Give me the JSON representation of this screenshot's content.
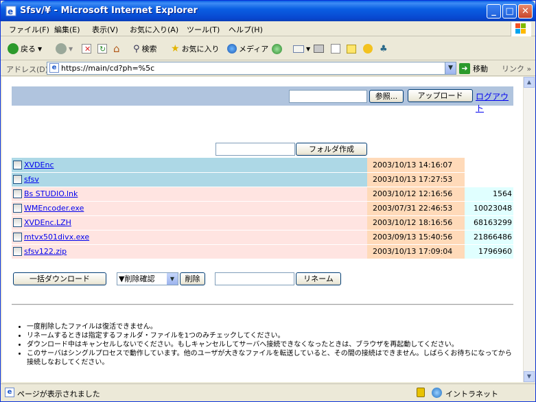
{
  "window": {
    "title": "Sfsv/¥ - Microsoft Internet Explorer",
    "minimize": "_",
    "maximize": "□",
    "close": "✕"
  },
  "menu": [
    "ファイル(F)",
    "編集(E)",
    "表示(V)",
    "お気に入り(A)",
    "ツール(T)",
    "ヘルプ(H)"
  ],
  "toolbar": {
    "back": "戻る",
    "search": "検索",
    "favorites": "お気に入り",
    "media": "メディア"
  },
  "address": {
    "label": "アドレス(D)",
    "url": "https://main/cd?ph=%5c",
    "go": "移動",
    "links": "リンク"
  },
  "upload": {
    "browse": "参照...",
    "upload": "アップロード",
    "logout": "ログアウト"
  },
  "folder": {
    "create": "フォルダ作成"
  },
  "files": [
    {
      "name": "XVDEnc",
      "date": "2003/10/13 14:16:07",
      "size": "",
      "kind": "dir"
    },
    {
      "name": "sfsv",
      "date": "2003/10/13 17:27:53",
      "size": "",
      "kind": "dir"
    },
    {
      "name": "Bs STUDIO.lnk",
      "date": "2003/10/12 12:16:56",
      "size": "1564",
      "kind": "file"
    },
    {
      "name": "WMEncoder.exe",
      "date": "2003/07/31 22:46:53",
      "size": "10023048",
      "kind": "file"
    },
    {
      "name": "XVDEnc.LZH",
      "date": "2003/10/12 18:16:56",
      "size": "68163299",
      "kind": "file"
    },
    {
      "name": "mtvx501divx.exe",
      "date": "2003/09/13 15:40:56",
      "size": "21866486",
      "kind": "file"
    },
    {
      "name": "sfsv122.zip",
      "date": "2003/10/13 17:09:04",
      "size": "1796960",
      "kind": "file"
    }
  ],
  "actions": {
    "bulk_download": "一括ダウンロード",
    "delete_confirm": "▼削除確認",
    "delete": "削除",
    "rename": "リネーム"
  },
  "notes": [
    "一度削除したファイルは復活できません。",
    "リネームするときは指定するフォルダ・ファイルを1つのみチェックしてください。",
    "ダウンロード中はキャンセルしないでください。もしキャンセルしてサーバへ接続できなくなったときは、ブラウザを再起動してください。",
    "このサーバはシングルプロセスで動作しています。他のユーザが大きなファイルを転送していると、その間の接続はできません。しばらくお待ちになってから接続しなおしてください。"
  ],
  "status": {
    "text": "ページが表示されました",
    "zone": "イントラネット"
  }
}
